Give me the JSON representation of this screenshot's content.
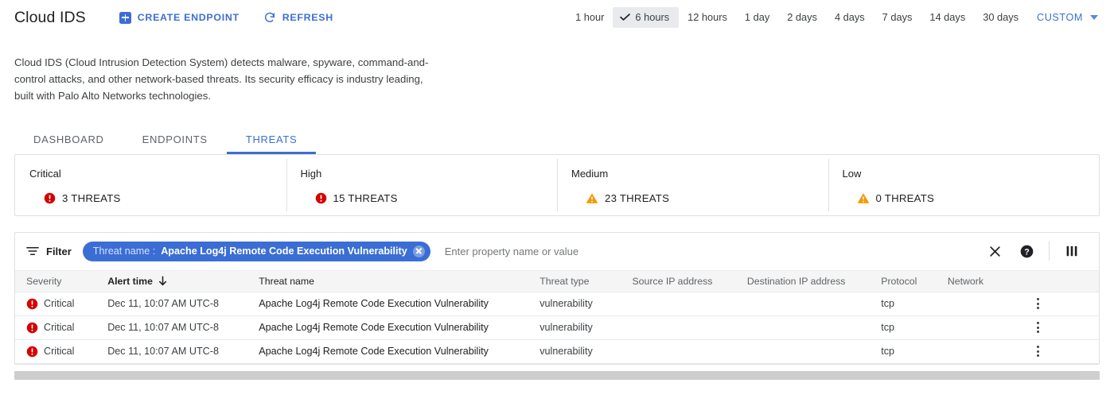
{
  "header": {
    "title": "Cloud IDS",
    "actions": [
      {
        "id": "create-endpoint",
        "label": "CREATE ENDPOINT",
        "icon": "plus-square-icon"
      },
      {
        "id": "refresh",
        "label": "REFRESH",
        "icon": "refresh-icon"
      }
    ]
  },
  "time_range": {
    "options": [
      "1 hour",
      "6 hours",
      "12 hours",
      "1 day",
      "2 days",
      "4 days",
      "7 days",
      "14 days",
      "30 days"
    ],
    "selected": "6 hours",
    "custom_label": "CUSTOM"
  },
  "description": "Cloud IDS (Cloud Intrusion Detection System) detects malware, spyware, command-and-control attacks, and other network-based threats. Its security efficacy is industry leading, built with Palo Alto Networks technologies.",
  "tabs": [
    {
      "label": "DASHBOARD",
      "active": false
    },
    {
      "label": "ENDPOINTS",
      "active": false
    },
    {
      "label": "THREATS",
      "active": true
    }
  ],
  "severity_cards": [
    {
      "label": "Critical",
      "count": "3 THREATS",
      "icon": "error-circle-icon",
      "color": "#d50000"
    },
    {
      "label": "High",
      "count": "15 THREATS",
      "icon": "error-circle-icon",
      "color": "#d50000"
    },
    {
      "label": "Medium",
      "count": "23 THREATS",
      "icon": "warning-triangle-icon",
      "color": "#f29900"
    },
    {
      "label": "Low",
      "count": "0 THREATS",
      "icon": "warning-triangle-icon",
      "color": "#f29900"
    }
  ],
  "filter_bar": {
    "label": "Filter",
    "chip": {
      "key": "Threat name :",
      "value": "Apache Log4j Remote Code Execution Vulnerability"
    },
    "placeholder": "Enter property name or value",
    "actions": [
      "close-icon",
      "help-icon",
      "columns-icon"
    ]
  },
  "table": {
    "columns": [
      {
        "key": "severity",
        "label": "Severity",
        "sorted": false
      },
      {
        "key": "alert_time",
        "label": "Alert time",
        "sorted": true,
        "sort_dir": "desc"
      },
      {
        "key": "threat_name",
        "label": "Threat name",
        "sorted": false
      },
      {
        "key": "threat_type",
        "label": "Threat type",
        "sorted": false
      },
      {
        "key": "source_ip",
        "label": "Source IP address",
        "sorted": false
      },
      {
        "key": "destination_ip",
        "label": "Destination IP address",
        "sorted": false
      },
      {
        "key": "protocol",
        "label": "Protocol",
        "sorted": false
      },
      {
        "key": "network",
        "label": "Network",
        "sorted": false
      }
    ],
    "rows": [
      {
        "severity": "Critical",
        "severity_icon": "error-circle-icon",
        "alert_time": "Dec 11, 10:07 AM UTC-8",
        "threat_name": "Apache Log4j Remote Code Execution Vulnerability",
        "threat_type": "vulnerability",
        "source_ip": "",
        "destination_ip": "",
        "protocol": "tcp",
        "network": ""
      },
      {
        "severity": "Critical",
        "severity_icon": "error-circle-icon",
        "alert_time": "Dec 11, 10:07 AM UTC-8",
        "threat_name": "Apache Log4j Remote Code Execution Vulnerability",
        "threat_type": "vulnerability",
        "source_ip": "",
        "destination_ip": "",
        "protocol": "tcp",
        "network": ""
      },
      {
        "severity": "Critical",
        "severity_icon": "error-circle-icon",
        "alert_time": "Dec 11, 10:07 AM UTC-8",
        "threat_name": "Apache Log4j Remote Code Execution Vulnerability",
        "threat_type": "vulnerability",
        "source_ip": "",
        "destination_ip": "",
        "protocol": "tcp",
        "network": ""
      }
    ]
  },
  "colors": {
    "accent_blue": "#3b6ed4",
    "critical_red": "#d50000",
    "warning_orange": "#f29900",
    "text_primary": "#202124",
    "text_secondary": "#5f6368"
  }
}
